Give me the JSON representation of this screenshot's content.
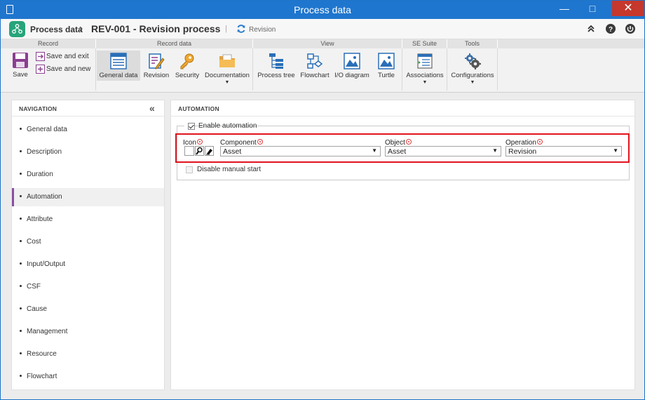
{
  "window": {
    "title": "Process data"
  },
  "header": {
    "breadcrumb_root": "Process data",
    "record_title": "REV-001 - Revision process",
    "mode_label": "Revision"
  },
  "ribbon": {
    "groups": {
      "record": "Record",
      "record_data": "Record data",
      "view": "View",
      "se_suite": "SE Suite",
      "tools": "Tools"
    },
    "buttons": {
      "save": "Save",
      "save_and_exit": "Save and exit",
      "save_and_new": "Save and new",
      "general_data": "General data",
      "revision": "Revision",
      "security": "Security",
      "documentation": "Documentation",
      "process_tree": "Process tree",
      "flowchart": "Flowchart",
      "io_diagram": "I/O diagram",
      "turtle": "Turtle",
      "associations": "Associations",
      "configurations": "Configurations"
    }
  },
  "navigation": {
    "title": "NAVIGATION",
    "items": [
      {
        "label": "General data"
      },
      {
        "label": "Description"
      },
      {
        "label": "Duration"
      },
      {
        "label": "Automation"
      },
      {
        "label": "Attribute"
      },
      {
        "label": "Cost"
      },
      {
        "label": "Input/Output"
      },
      {
        "label": "CSF"
      },
      {
        "label": "Cause"
      },
      {
        "label": "Management"
      },
      {
        "label": "Resource"
      },
      {
        "label": "Flowchart"
      }
    ],
    "active_index": 3
  },
  "automation": {
    "title": "AUTOMATION",
    "enable_label": "Enable automation",
    "enable_checked": true,
    "fields": {
      "icon_label": "Icon",
      "component_label": "Component",
      "component_value": "Asset",
      "object_label": "Object",
      "object_value": "Asset",
      "operation_label": "Operation",
      "operation_value": "Revision"
    },
    "disable_manual_label": "Disable manual start",
    "disable_manual_checked": false
  },
  "icons": {
    "app": "document-icon",
    "logo": "process-logo-icon",
    "revision": "revision-cycle-icon",
    "collapse": "double-chevron-left-icon",
    "search": "magnifier-icon",
    "clear": "eraser-icon",
    "required": "required-field-icon"
  },
  "colors": {
    "titlebar": "#1f76ce",
    "close": "#c6372c",
    "active_nav_bar": "#8b4ea3",
    "highlight": "#e0141e",
    "logo": "#27a47a"
  }
}
